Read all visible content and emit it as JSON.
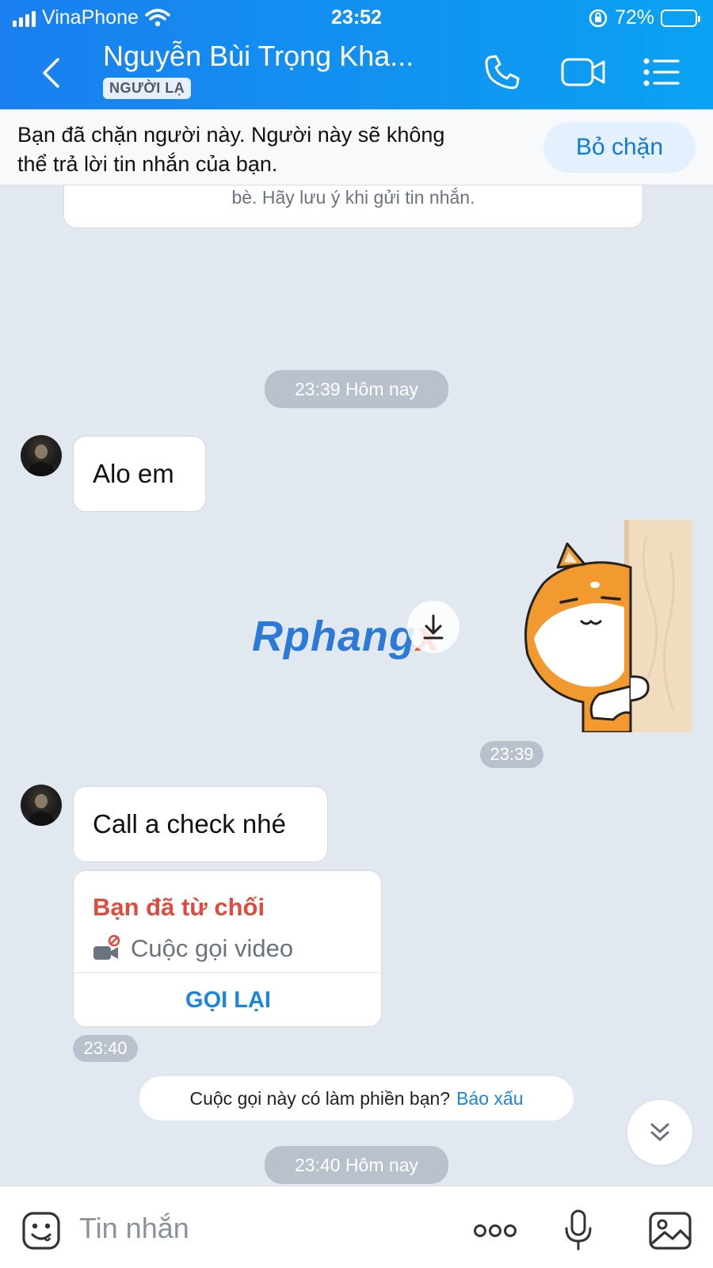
{
  "status_bar": {
    "carrier": "VinaPhone",
    "time": "23:52",
    "battery_percent": "72%",
    "battery_level": 0.72
  },
  "header": {
    "contact_name": "Nguyễn Bùi Trọng Kha...",
    "badge": "NGƯỜI LẠ",
    "icons": [
      "back-icon",
      "phone-icon",
      "video-call-icon",
      "menu-icon"
    ],
    "colors": {
      "gradient_start": "#1a7ff0",
      "gradient_end": "#0aa2f2"
    }
  },
  "block_banner": {
    "line1": "Bạn đã chặn người này. Người này sẽ không",
    "line2": "thể trả lời tin nhắn của bạn.",
    "unblock_label": "Bỏ chặn"
  },
  "notice": {
    "text": "bè. Hãy lưu ý khi gửi tin nhắn."
  },
  "messages": {
    "divider1": "23:39 Hôm nay",
    "msg1": "Alo em",
    "sticker_time": "23:39",
    "msg2": "Call a check nhé",
    "call_card": {
      "status": "Bạn đã từ chối",
      "type": "Cuộc gọi video",
      "action": "GỌI LẠI",
      "time": "23:40"
    },
    "prompt_text": "Cuộc gọi này có làm phiền bạn?",
    "prompt_link": "Báo xấu",
    "divider2": "23:40 Hôm nay"
  },
  "watermark": {
    "part1": "Rphang",
    "part2": "x"
  },
  "composer": {
    "placeholder": "Tin nhắn",
    "icons": [
      "emoji-icon",
      "more-icon",
      "microphone-icon",
      "image-icon"
    ]
  },
  "colors": {
    "accent": "#1a86e0",
    "declined": "#e04b3f",
    "chat_background": "#e2e8f0"
  }
}
